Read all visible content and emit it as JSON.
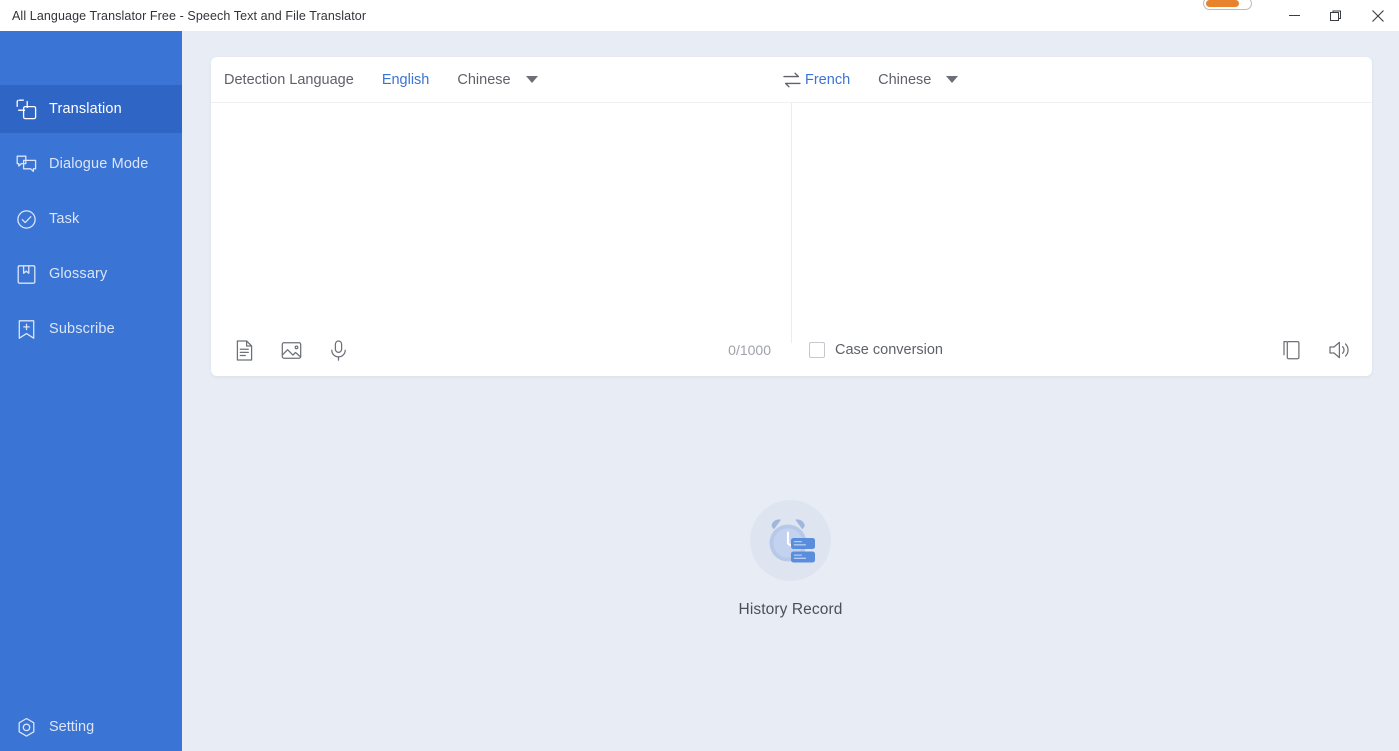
{
  "window": {
    "title": "All Language Translator Free - Speech Text and File Translator",
    "trial_indicator": "trial-progress-pill",
    "controls": {
      "minimize": "minimize-icon",
      "maximize": "maximize-icon",
      "close": "close-icon"
    }
  },
  "colors": {
    "sidebar": "#3a74d4",
    "sidebar_active": "#2f66c6",
    "accent": "#3a74d4",
    "background": "#e8ecf4",
    "card": "#ffffff",
    "trial_fill": "#e8822c",
    "empty_circle": "#dfe5f0"
  },
  "sidebar": {
    "items": [
      {
        "label": "Translation",
        "icon": "translation-icon",
        "active": true
      },
      {
        "label": "Dialogue Mode",
        "icon": "dialogue-icon",
        "active": false
      },
      {
        "label": "Task",
        "icon": "check-circle-icon",
        "active": false
      },
      {
        "label": "Glossary",
        "icon": "book-bookmark-icon",
        "active": false
      },
      {
        "label": "Subscribe",
        "icon": "bookmark-plus-icon",
        "active": false
      }
    ],
    "setting": {
      "label": "Setting",
      "icon": "gear-icon"
    }
  },
  "translator": {
    "source": {
      "detect_label": "Detection Language",
      "recent": "English",
      "selected": "Chinese",
      "dropdown_icon": "chevron-down-icon",
      "text_value": "",
      "placeholder": "",
      "char_count": "0/1000",
      "tools": [
        {
          "name": "document-icon",
          "label": "Document translate"
        },
        {
          "name": "image-icon",
          "label": "Image translate"
        },
        {
          "name": "microphone-icon",
          "label": "Voice input"
        }
      ]
    },
    "swap": {
      "icon": "swap-arrows-icon",
      "label": "Swap languages"
    },
    "target": {
      "recent": "French",
      "selected": "Chinese",
      "dropdown_icon": "chevron-down-icon",
      "text_value": "",
      "placeholder": "",
      "case_conversion": {
        "label": "Case conversion",
        "checked": false
      },
      "tools": [
        {
          "name": "copy-icon",
          "label": "Copy"
        },
        {
          "name": "speaker-icon",
          "label": "Read aloud"
        }
      ]
    }
  },
  "history": {
    "icon": "alarm-clock-records-icon",
    "label": "History Record"
  }
}
